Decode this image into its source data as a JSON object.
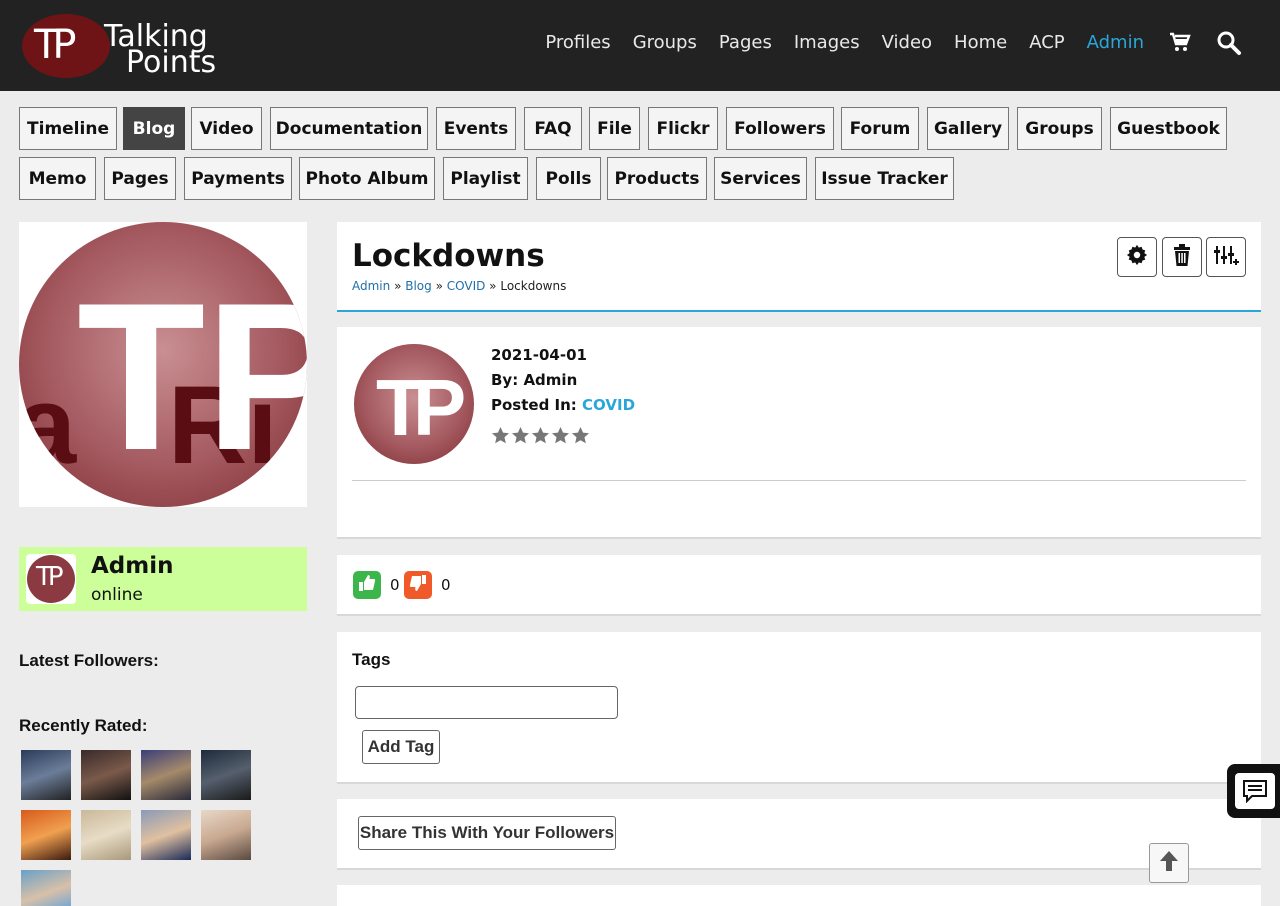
{
  "header": {
    "logo_line1": "Talking",
    "logo_line2": "Points",
    "logo_mark": "TP",
    "nav": [
      "Profiles",
      "Groups",
      "Pages",
      "Images",
      "Video",
      "Home",
      "ACP",
      "Admin"
    ],
    "active_nav": "Admin",
    "icons": [
      "cart-icon",
      "search-icon"
    ]
  },
  "tabs": [
    "Timeline",
    "Blog",
    "Video",
    "Documentation",
    "Events",
    "FAQ",
    "File",
    "Flickr",
    "Followers",
    "Forum",
    "Gallery",
    "Groups",
    "Guestbook",
    "Memo",
    "Pages",
    "Payments",
    "Photo Album",
    "Playlist",
    "Polls",
    "Products",
    "Services",
    "Issue Tracker"
  ],
  "active_tab": "Blog",
  "profile": {
    "name": "Admin",
    "status": "online",
    "latest_followers_label": "Latest Followers:",
    "recently_rated_label": "Recently Rated:"
  },
  "post": {
    "title": "Lockdowns",
    "breadcrumb": [
      "Admin",
      "Blog",
      "COVID",
      "Lockdowns"
    ],
    "date": "2021-04-01",
    "by_label": "By:",
    "author": "Admin",
    "posted_in_label": "Posted In:",
    "category": "COVID",
    "rating": 0,
    "rating_max": 5
  },
  "votes": {
    "likes": "0",
    "dislikes": "0"
  },
  "tags": {
    "title": "Tags",
    "input_value": "",
    "add_label": "Add Tag"
  },
  "share": {
    "label": "Share This With Your Followers"
  },
  "colors": {
    "accent": "#2aa6d8",
    "header_bg": "#222222",
    "online_bg": "#ccff99",
    "like": "#3cb54a",
    "dislike": "#f05a28"
  }
}
